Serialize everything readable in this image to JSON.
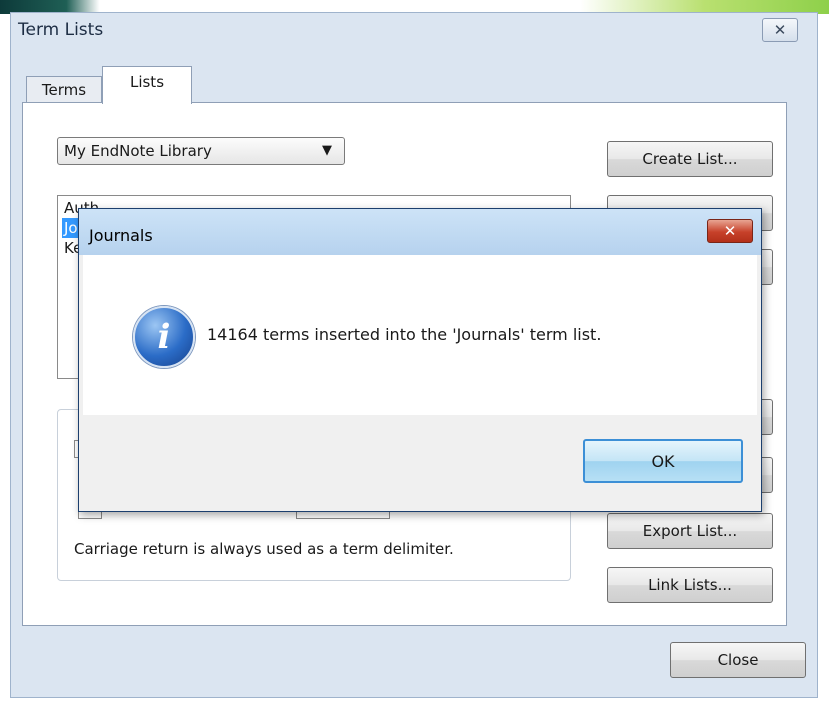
{
  "window": {
    "title": "Term Lists",
    "close_icon": "✕"
  },
  "tabs": [
    {
      "label": "Terms",
      "active": false
    },
    {
      "label": "Lists",
      "active": true
    }
  ],
  "library_select": {
    "value": "My EndNote Library",
    "arrow": "▼"
  },
  "term_lists": [
    {
      "label": "Auth",
      "selected": false
    },
    {
      "label": "Jo",
      "selected": true
    },
    {
      "label": "Ke",
      "selected": false
    }
  ],
  "buttons": {
    "create_list": "Create List...",
    "export_list": "Export List...",
    "link_lists": "Link Lists...",
    "close": "Close"
  },
  "delimiter_note": "Carriage return is always used as a term delimiter.",
  "dialog": {
    "title": "Journals",
    "close_icon": "✕",
    "info_glyph": "i",
    "message": "14164 terms inserted into the 'Journals' term list.",
    "ok_label": "OK"
  },
  "colors": {
    "selection": "#3399ff",
    "dialog_titlebar": "#b6d2ee",
    "close_red": "#c7412a"
  }
}
